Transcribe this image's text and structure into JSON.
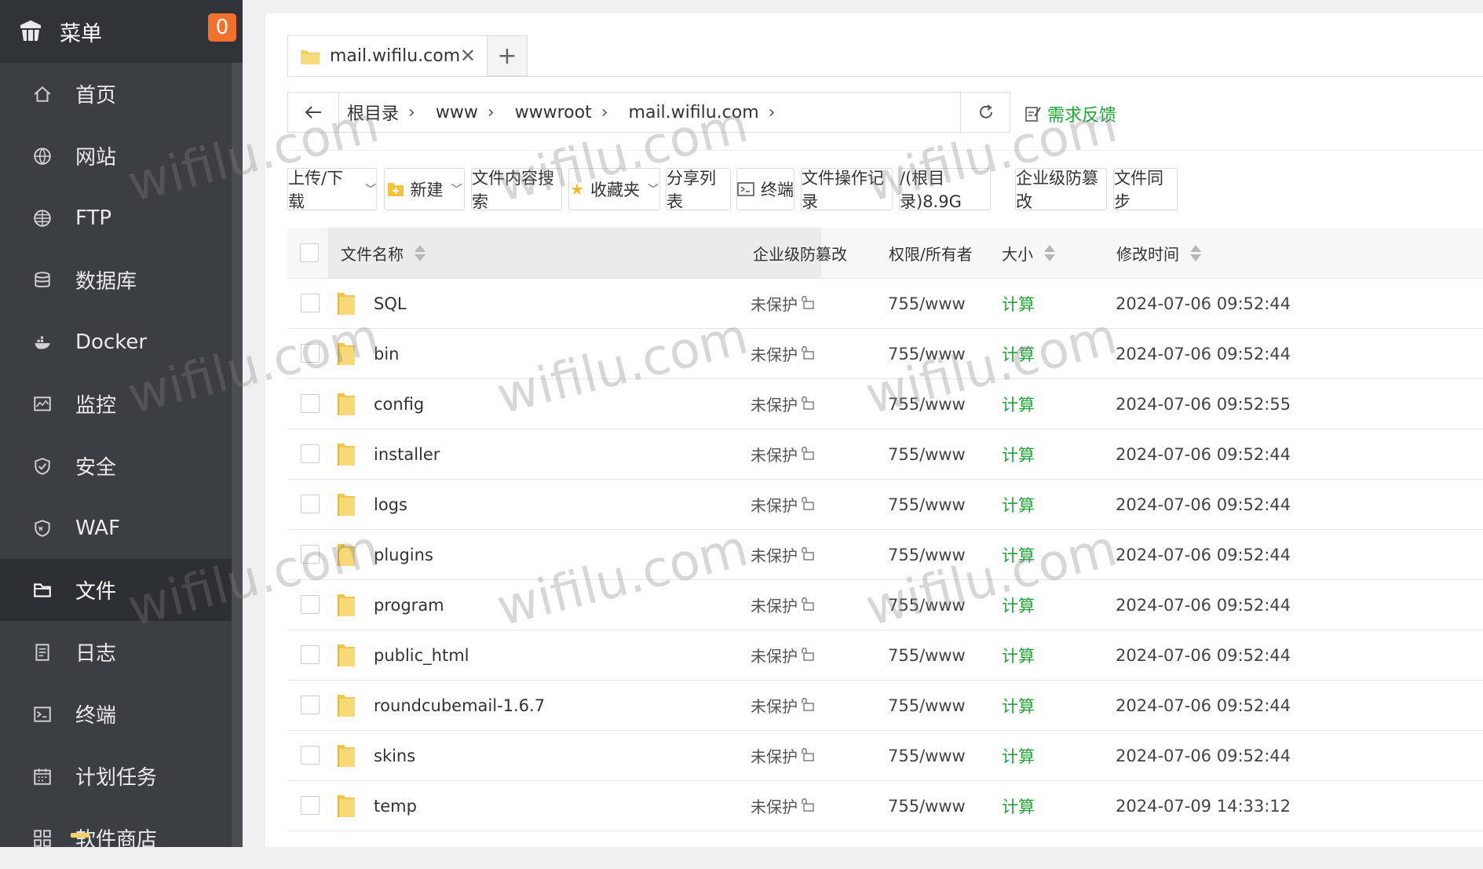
{
  "sidebar": {
    "title": "菜单",
    "badge": "0",
    "items": [
      {
        "label": "首页",
        "icon": "home-icon"
      },
      {
        "label": "网站",
        "icon": "globe-icon"
      },
      {
        "label": "FTP",
        "icon": "ftp-globe-icon"
      },
      {
        "label": "数据库",
        "icon": "database-icon"
      },
      {
        "label": "Docker",
        "icon": "docker-icon"
      },
      {
        "label": "监控",
        "icon": "monitor-icon"
      },
      {
        "label": "安全",
        "icon": "shield-icon"
      },
      {
        "label": "WAF",
        "icon": "waf-shield-icon"
      },
      {
        "label": "文件",
        "icon": "folder-icon"
      },
      {
        "label": "日志",
        "icon": "log-icon"
      },
      {
        "label": "终端",
        "icon": "terminal-icon"
      },
      {
        "label": "计划任务",
        "icon": "calendar-icon"
      },
      {
        "label": "软件商店",
        "icon": "apps-icon"
      }
    ],
    "active_index": 8
  },
  "tabs": [
    {
      "label": "mail.wifilu.com"
    }
  ],
  "tab_add": "+",
  "breadcrumbs": [
    "根目录",
    "www",
    "wwwroot",
    "mail.wifilu.com"
  ],
  "feedback": "需求反馈",
  "toolbar": {
    "upload": "上传/下载",
    "new": "新建",
    "content_search": "文件内容搜索",
    "favorites": "收藏夹",
    "share_list": "分享列表",
    "terminal": "终端",
    "op_log": "文件操作记录",
    "disk": "/(根目录)8.9G",
    "tamper": "企业级防篡改",
    "sync": "文件同步"
  },
  "table": {
    "headers": {
      "name": "文件名称",
      "tamper": "企业级防篡改",
      "perm": "权限/所有者",
      "size": "大小",
      "mtime": "修改时间"
    },
    "rows": [
      {
        "name": "SQL",
        "tamper": "未保护",
        "perm": "755/www",
        "size": "计算",
        "mtime": "2024-07-06 09:52:44"
      },
      {
        "name": "bin",
        "tamper": "未保护",
        "perm": "755/www",
        "size": "计算",
        "mtime": "2024-07-06 09:52:44"
      },
      {
        "name": "config",
        "tamper": "未保护",
        "perm": "755/www",
        "size": "计算",
        "mtime": "2024-07-06 09:52:55"
      },
      {
        "name": "installer",
        "tamper": "未保护",
        "perm": "755/www",
        "size": "计算",
        "mtime": "2024-07-06 09:52:44"
      },
      {
        "name": "logs",
        "tamper": "未保护",
        "perm": "755/www",
        "size": "计算",
        "mtime": "2024-07-06 09:52:44"
      },
      {
        "name": "plugins",
        "tamper": "未保护",
        "perm": "755/www",
        "size": "计算",
        "mtime": "2024-07-06 09:52:44"
      },
      {
        "name": "program",
        "tamper": "未保护",
        "perm": "755/www",
        "size": "计算",
        "mtime": "2024-07-06 09:52:44"
      },
      {
        "name": "public_html",
        "tamper": "未保护",
        "perm": "755/www",
        "size": "计算",
        "mtime": "2024-07-06 09:52:44"
      },
      {
        "name": "roundcubemail-1.6.7",
        "tamper": "未保护",
        "perm": "755/www",
        "size": "计算",
        "mtime": "2024-07-06 09:52:44"
      },
      {
        "name": "skins",
        "tamper": "未保护",
        "perm": "755/www",
        "size": "计算",
        "mtime": "2024-07-06 09:52:44"
      },
      {
        "name": "temp",
        "tamper": "未保护",
        "perm": "755/www",
        "size": "计算",
        "mtime": "2024-07-09 14:33:12"
      }
    ]
  },
  "watermark": "wifilu.com",
  "colors": {
    "accent_green": "#20a53a",
    "sidebar_bg": "#3b3e43",
    "badge": "#f0702c",
    "folder": "#f3d167"
  }
}
